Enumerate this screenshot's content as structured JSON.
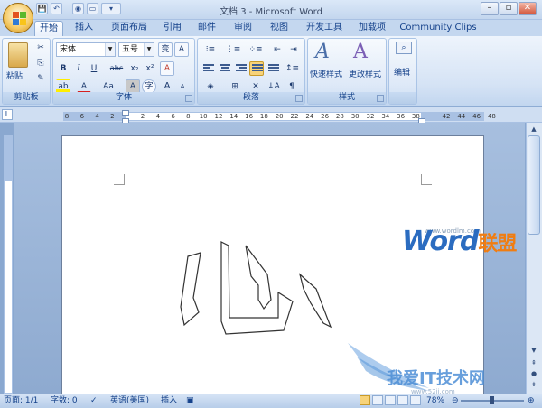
{
  "window": {
    "title": "文档 3 - Microsoft Word"
  },
  "qat": {
    "save": "💾",
    "undo": "↶",
    "redo": "◉",
    "print": "▭",
    "custom": "▾"
  },
  "window_controls": {
    "minimize": "–",
    "maximize": "▫",
    "close": "✕"
  },
  "tabs": [
    "开始",
    "插入",
    "页面布局",
    "引用",
    "邮件",
    "审阅",
    "视图",
    "开发工具",
    "加载项",
    "Community Clips"
  ],
  "ribbon": {
    "clipboard": {
      "paste_label": "粘贴",
      "group_label": "剪贴板"
    },
    "font": {
      "font_name": "宋体",
      "font_size": "五号",
      "group_label": "字体",
      "wen_btn": "变",
      "a_box": "A",
      "bold": "B",
      "italic": "I",
      "underline": "U",
      "strike": "abc",
      "subscript": "x₂",
      "superscript": "x²",
      "clear": "A",
      "font_color": "A",
      "change_case": "Aa",
      "char_shade": "A",
      "enclose": "字",
      "grow": "A",
      "shrink": "A"
    },
    "paragraph": {
      "group_label": "段落"
    },
    "styles": {
      "quick_styles": "快速样式",
      "change_styles": "更改样式",
      "group_label": "样式"
    },
    "editing": {
      "label": "编辑",
      "group_label": ""
    }
  },
  "ruler": {
    "ticks": [
      "8",
      "6",
      "4",
      "2",
      "",
      "2",
      "4",
      "6",
      "8",
      "10",
      "12",
      "14",
      "16",
      "18",
      "20",
      "22",
      "24",
      "26",
      "28",
      "30",
      "32",
      "34",
      "36",
      "38",
      "",
      "42",
      "44",
      "46",
      "48"
    ]
  },
  "status": {
    "page": "页面: 1/1",
    "words": "字数: 0",
    "language": "英语(美国)",
    "mode": "插入",
    "zoom": "78%"
  },
  "watermark": {
    "word": "Word",
    "cn": "联盟",
    "url": "www.wordlm.com",
    "site": "我爱IT技术网",
    "site_url": "www.52ij.com"
  },
  "colors": {
    "accent": "#15428b",
    "ribbon_bg": "#d5e3f5",
    "office_orb": "#f4c860"
  }
}
